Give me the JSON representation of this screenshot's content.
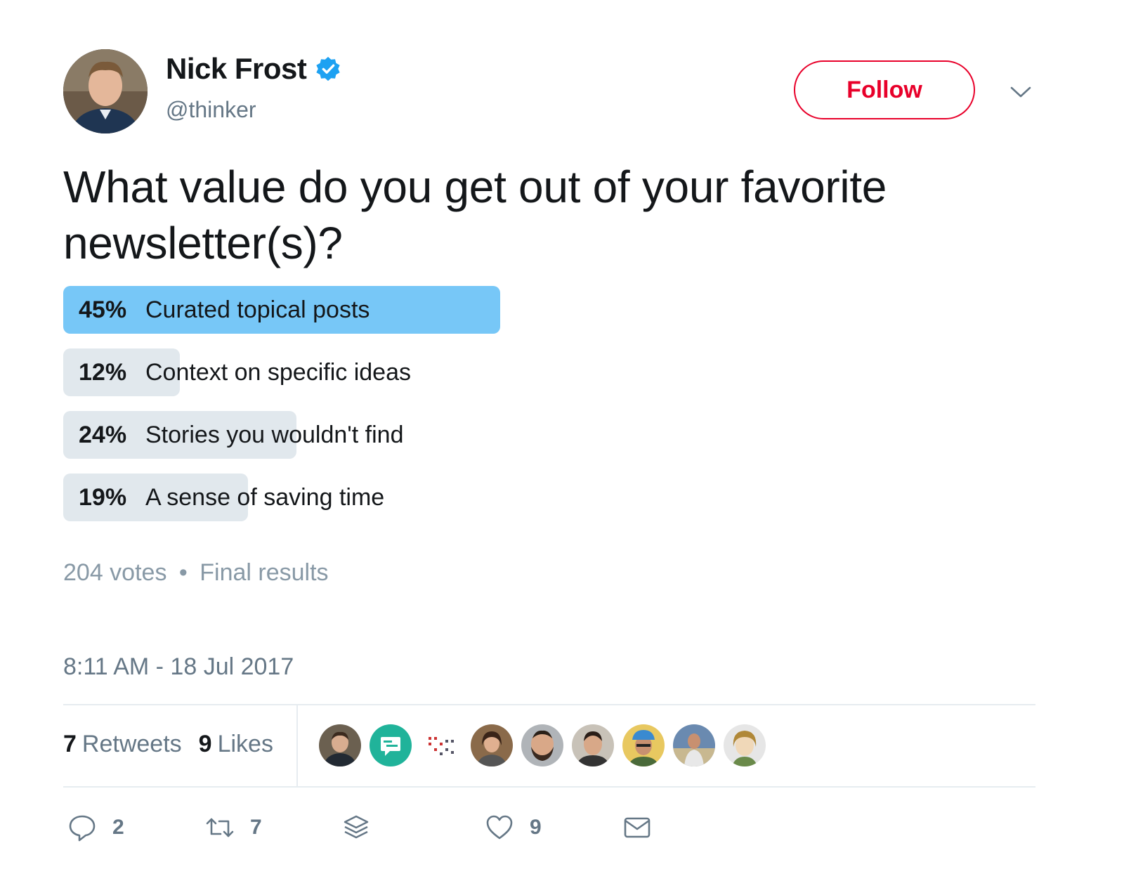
{
  "author": {
    "name": "Nick Frost",
    "handle": "@thinker",
    "verified": true
  },
  "follow_label": "Follow",
  "tweet": {
    "text": "What value do you get out of your favorite newsletter(s)?"
  },
  "poll": {
    "options": [
      {
        "pct_label": "45%",
        "percent": 45,
        "label": "Curated topical posts",
        "winner": true
      },
      {
        "pct_label": "12%",
        "percent": 12,
        "label": "Context on specific ideas",
        "winner": false
      },
      {
        "pct_label": "24%",
        "percent": 24,
        "label": "Stories you wouldn't find",
        "winner": false
      },
      {
        "pct_label": "19%",
        "percent": 19,
        "label": "A sense of saving time",
        "winner": false
      }
    ],
    "votes": "204 votes",
    "separator": "•",
    "status": "Final results"
  },
  "timestamp": "8:11 AM - 18 Jul 2017",
  "stats": {
    "retweets_count": "7",
    "retweets_label": "Retweets",
    "likes_count": "9",
    "likes_label": "Likes"
  },
  "actions": {
    "reply_count": "2",
    "retweet_count": "7",
    "like_count": "9"
  },
  "colors": {
    "follow": "#e8002a",
    "poll_winner": "#77c7f7",
    "poll_other": "#e1e8ed",
    "verified": "#1da1f2",
    "muted": "#657786"
  },
  "icons": [
    "verified-badge-icon",
    "chevron-down-icon",
    "reply-icon",
    "retweet-icon",
    "buffer-icon",
    "heart-icon",
    "envelope-icon"
  ]
}
